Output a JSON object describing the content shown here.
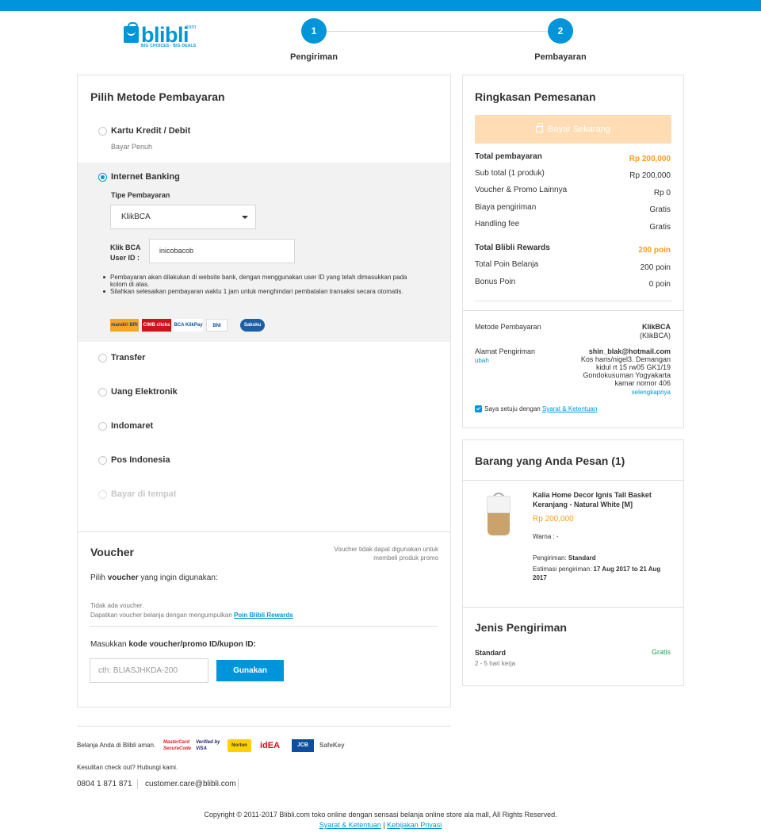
{
  "colors": {
    "brand": "#0095da",
    "orange": "#f99b1c",
    "green": "#23a45a",
    "pay_disabled": "#ffdcb3"
  },
  "header": {
    "logo_text": "blibli",
    "logo_com": ".com",
    "logo_tagline": "BIG CHOICES · BIG DEALS",
    "steps": [
      {
        "number": "1",
        "label": "Pengiriman"
      },
      {
        "number": "2",
        "label": "Pembayaran"
      }
    ]
  },
  "payment": {
    "title": "Pilih Metode Pembayaran",
    "credit": {
      "label": "Kartu Kredit / Debit",
      "sub": "Bayar Penuh"
    },
    "internet_banking": {
      "label": "Internet Banking",
      "type_label": "Tipe Pembayaran",
      "selected_type": "KlikBCA",
      "user_id_label": "Klik BCA User ID :",
      "user_id_value": "inicobacob",
      "notes": [
        "Pembayaran akan dilakukan di website bank, dengan menggunakan user ID yang telah dimasukkan pada kolom di atas.",
        "Silahkan selesaikan pembayaran waktu 1 jam untuk menghindari pembatalan transaksi secara otomatis."
      ],
      "banks": [
        "mandiri BRI",
        "CIMB clicks",
        "BCA KlikPay",
        "BNI",
        "Sakuku"
      ]
    },
    "options": [
      {
        "label": "Transfer",
        "disabled": false
      },
      {
        "label": "Uang Elektronik",
        "disabled": false
      },
      {
        "label": "Indomaret",
        "disabled": false
      },
      {
        "label": "Pos Indonesia",
        "disabled": false
      },
      {
        "label": "Bayar di tempat",
        "disabled": true
      }
    ]
  },
  "voucher": {
    "title": "Voucher",
    "notice": "Voucher tidak dapat digunakan untuk membeli produk promo",
    "choose_prefix": "Pilih ",
    "choose_bold": "voucher",
    "choose_suffix": " yang ingin digunakan:",
    "none_text": "Tidak ada voucher.",
    "collect_text": "Dapatkan voucher belanja dengan mengumpulkan ",
    "collect_link": "Poin Blibli Rewards",
    "code_prefix": "Masukkan ",
    "code_bold": "kode voucher/promo ID/kupon ID:",
    "placeholder": "cth: BLIASJHKDA-200",
    "apply_button": "Gunakan"
  },
  "summary": {
    "title": "Ringkasan Pemesanan",
    "pay_button": "Bayar Sekarang",
    "rows": [
      {
        "label": "Total pembayaran",
        "value": "Rp 200,000"
      },
      {
        "label": "Sub total (1 produk)",
        "value": "Rp 200,000"
      },
      {
        "label": "Voucher & Promo Lainnya",
        "value": "Rp 0"
      },
      {
        "label": "Biaya pengiriman",
        "value": "Gratis"
      },
      {
        "label": "Handling fee",
        "value": "Gratis"
      }
    ],
    "rewards": [
      {
        "label": "Total Blibli Rewards",
        "value": "200 poin"
      },
      {
        "label": "Total Poin Belanja",
        "value": "200 poin"
      },
      {
        "label": "Bonus Poin",
        "value": "0 poin"
      }
    ],
    "method_label": "Metode Pembayaran",
    "method_value": "KlikBCA",
    "method_sub": "(KlikBCA)",
    "address_label": "Alamat Pengiriman",
    "address_change": "ubah",
    "address_email": "shin_blak@hotmail.com",
    "address_lines": [
      "Kos haris/nigel3. Demangan",
      "kidul rt 15 rw05 GK1/19",
      "Gondokusuman Yogyakarta",
      "kamar nomor 406"
    ],
    "address_more": "selengkapnya",
    "agree_prefix": "Saya setuju dengan ",
    "agree_link": "Syarat & Ketentuan"
  },
  "items": {
    "title": "Barang yang Anda Pesan (1)",
    "product_name": "Kalia Home Decor Ignis Tall Basket Keranjang - Natural White [M]",
    "price": "Rp 200,000",
    "color": "Warna : -",
    "shipping_label": "Pengiriman: ",
    "shipping_value": "Standard",
    "estimate_label": "Estimasi pengiriman: ",
    "estimate_value": "17 Aug 2017 to 21 Aug 2017"
  },
  "shipping": {
    "title": "Jenis Pengiriman",
    "type": "Standard",
    "duration": "2 - 5 hari kerja",
    "cost": "Gratis"
  },
  "footer": {
    "safe_text": "Belanja Anda di Blibli aman.",
    "seals": [
      "MasterCard SecureCode",
      "Verified by VISA",
      "Norton",
      "idEA",
      "JCB",
      "SafeKey"
    ],
    "help_text": "Kesulitan check out? Hubungi kami.",
    "phone": "0804 1 871 871",
    "email": "customer.care@blibli.com",
    "copyright": "Copyright © 2011-2017 Blibli.com toko online dengan sensasi belanja online store ala mall, All Rights Reserved.",
    "terms": "Syarat & Ketentuan",
    "privacy": "Kebijakan Privasi"
  }
}
